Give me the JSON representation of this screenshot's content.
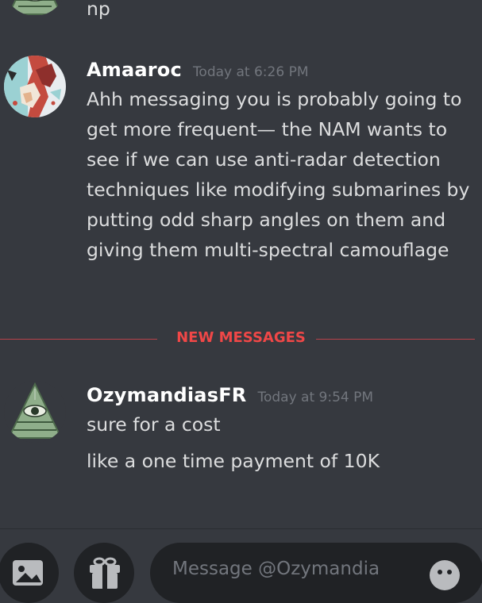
{
  "messages": {
    "prev": {
      "text": "np"
    },
    "amaaroc": {
      "username": "Amaaroc",
      "timestamp": "Today at 6:26 PM",
      "text": "Ahh messaging you is probably going to get more frequent— the NAM wants to see if we can use anti-radar detection techniques like modifying submarines by putting odd sharp angles on them and giving them multi-spectral camouflage"
    },
    "ozymandias": {
      "username": "OzymandiasFR",
      "timestamp": "Today at 9:54 PM",
      "lines": [
        "sure for a cost",
        "like a one time payment of 10K"
      ]
    }
  },
  "divider": {
    "label": "NEW MESSAGES"
  },
  "composer": {
    "placeholder": "Message @Ozymandia"
  },
  "colors": {
    "background": "#36393f",
    "divider": "#f04747",
    "timestamp": "#72767d",
    "username": "#ffffff",
    "text": "#dcddde"
  },
  "icons": {
    "upload": "image-upload-icon",
    "gift": "gift-icon",
    "emoji": "emoji-icon",
    "pyramid_avatar": "eye-pyramid-avatar",
    "art_avatar": "fox-art-avatar"
  }
}
